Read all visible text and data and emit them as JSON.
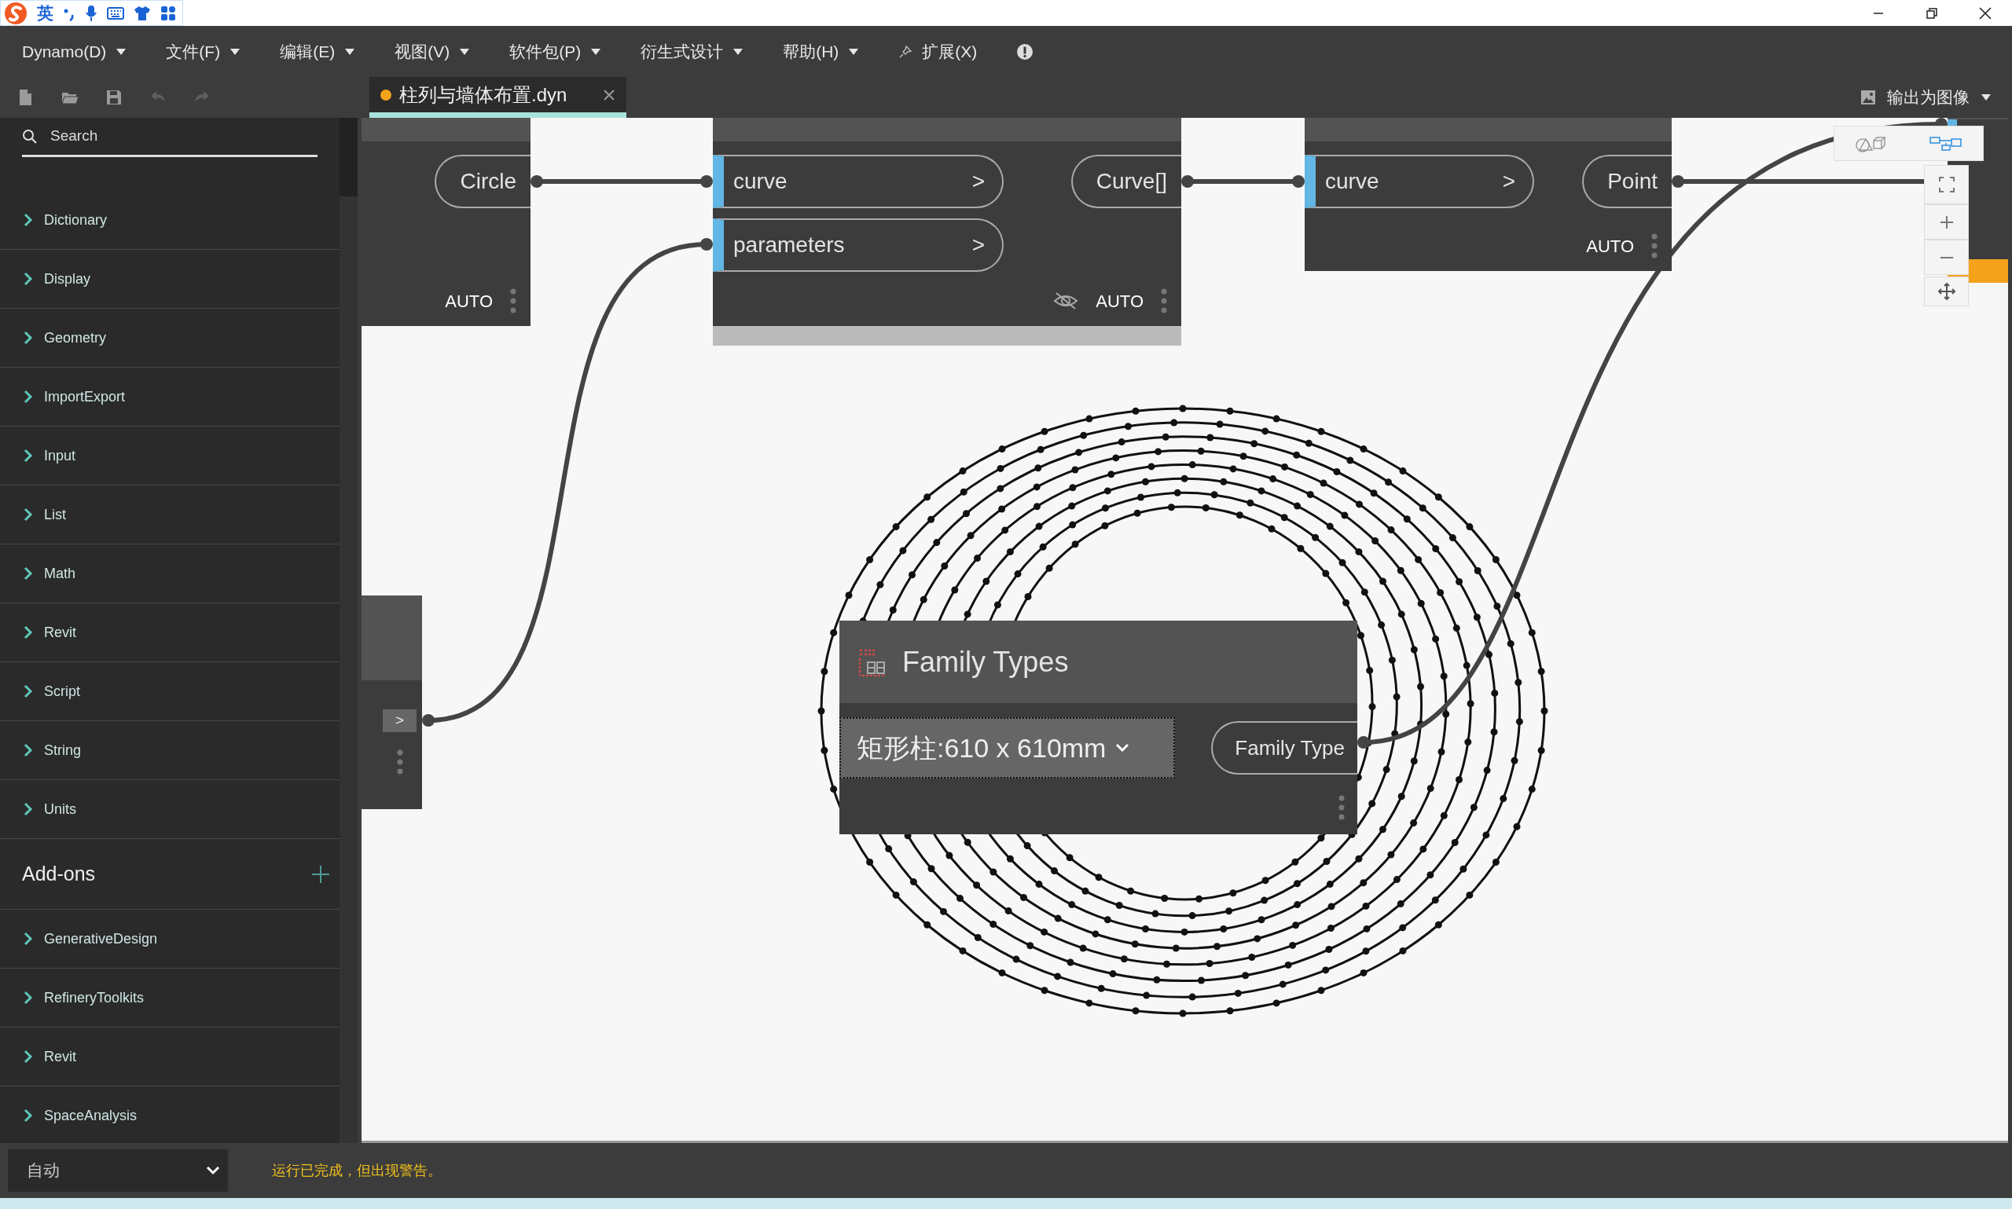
{
  "title_bar": {
    "ime_language": "英"
  },
  "menu": [
    {
      "label": "Dynamo(D)",
      "kind": "dropdown"
    },
    {
      "label": "文件(F)",
      "kind": "dropdown"
    },
    {
      "label": "编辑(E)",
      "kind": "dropdown"
    },
    {
      "label": "视图(V)",
      "kind": "dropdown"
    },
    {
      "label": "软件包(P)",
      "kind": "dropdown"
    },
    {
      "label": "衍生式设计",
      "kind": "dropdown"
    },
    {
      "label": "帮助(H)",
      "kind": "dropdown"
    },
    {
      "label": "扩展(X)",
      "kind": "pinned"
    }
  ],
  "toolbar": [
    {
      "kind": "new",
      "disabled": false
    },
    {
      "kind": "open",
      "disabled": false
    },
    {
      "kind": "save",
      "disabled": false
    },
    {
      "kind": "undo",
      "disabled": true
    },
    {
      "kind": "redo",
      "disabled": true
    }
  ],
  "tabs": [
    {
      "label": "柱列与墙体布置.dyn",
      "selected": true,
      "modified": true
    }
  ],
  "export_button": {
    "label": "输出为图像"
  },
  "library": {
    "search": {
      "placeholder": "Search"
    },
    "categories": [
      {
        "label": "Dictionary"
      },
      {
        "label": "Display"
      },
      {
        "label": "Geometry"
      },
      {
        "label": "ImportExport"
      },
      {
        "label": "Input"
      },
      {
        "label": "List"
      },
      {
        "label": "Math"
      },
      {
        "label": "Revit"
      },
      {
        "label": "Script"
      },
      {
        "label": "String"
      },
      {
        "label": "Units"
      }
    ],
    "addons": {
      "title": "Add-ons",
      "items": [
        {
          "label": "GenerativeDesign"
        },
        {
          "label": "RefineryToolkits"
        },
        {
          "label": "Revit"
        },
        {
          "label": "SpaceAnalysis"
        }
      ]
    }
  },
  "canvas": {
    "view_toggle": [
      {
        "kind": "geometry",
        "selected": false
      },
      {
        "kind": "graph",
        "selected": true
      }
    ],
    "nodes": [
      {
        "kind": "standard",
        "outputs": [
          "Circle"
        ],
        "run_mode": "AUTO"
      },
      {
        "kind": "standard",
        "inputs": [
          {
            "name": "curve",
            "marker": ">"
          },
          {
            "name": "parameters",
            "marker": ">"
          }
        ],
        "outputs": [
          "Curve[]"
        ],
        "run_mode": "AUTO",
        "preview_hidden": true,
        "preview_bar": true
      },
      {
        "kind": "standard",
        "inputs": [
          {
            "name": "curve",
            "marker": ">"
          }
        ],
        "outputs": [
          "Point"
        ],
        "run_mode": "AUTO"
      },
      {
        "kind": "stub",
        "port_marker": ">"
      },
      {
        "kind": "family-types",
        "title": "Family Types",
        "value": "矩形柱:610 x 610mm",
        "outputs": [
          "Family Type"
        ]
      },
      {
        "kind": "clipped",
        "warning": true
      }
    ]
  },
  "status_bar": {
    "run_mode": "自动",
    "message": "运行已完成，但出现警告。"
  }
}
